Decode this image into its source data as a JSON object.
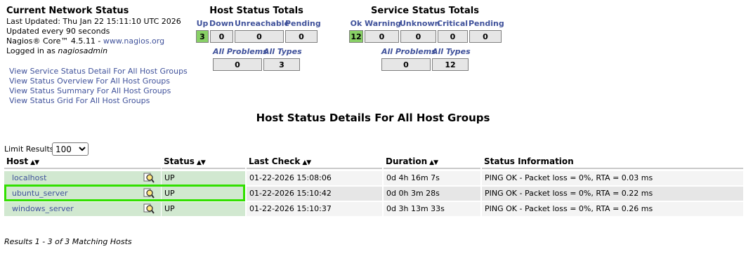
{
  "info": {
    "title": "Current Network Status",
    "last_updated": "Last Updated: Thu Jan 22 15:11:10 UTC 2026",
    "update_interval": "Updated every 90 seconds",
    "version_prefix": "Nagios® Core™ 4.5.11 - ",
    "version_link": "www.nagios.org",
    "logged_in_prefix": "Logged in as ",
    "user": "nagiosadmin"
  },
  "host_totals": {
    "title": "Host Status Totals",
    "headers": [
      "Up",
      "Down",
      "Unreachable",
      "Pending"
    ],
    "values": [
      "3",
      "0",
      "0",
      "0"
    ],
    "sub_headers": [
      "All Problems",
      "All Types"
    ],
    "sub_values": [
      "0",
      "3"
    ]
  },
  "service_totals": {
    "title": "Service Status Totals",
    "headers": [
      "Ok",
      "Warning",
      "Unknown",
      "Critical",
      "Pending"
    ],
    "values": [
      "12",
      "0",
      "0",
      "0",
      "0"
    ],
    "sub_headers": [
      "All Problems",
      "All Types"
    ],
    "sub_values": [
      "0",
      "12"
    ]
  },
  "links": [
    "View Service Status Detail For All Host Groups",
    "View Status Overview For All Host Groups",
    "View Status Summary For All Host Groups",
    "View Status Grid For All Host Groups"
  ],
  "page_title": "Host Status Details For All Host Groups",
  "limit": {
    "label": "Limit Results:",
    "selected": "100"
  },
  "columns": [
    "Host",
    "Status",
    "Last Check",
    "Duration",
    "Status Information"
  ],
  "hosts": [
    {
      "host": "localhost",
      "status": "UP",
      "last_check": "01-22-2026 15:08:06",
      "duration": "0d 4h 16m 7s",
      "info": "PING OK - Packet loss = 0%, RTA = 0.03 ms"
    },
    {
      "host": "ubuntu_server",
      "status": "UP",
      "last_check": "01-22-2026 15:10:42",
      "duration": "0d 0h 3m 28s",
      "info": "PING OK - Packet loss = 0%, RTA = 0.22 ms"
    },
    {
      "host": "windows_server",
      "status": "UP",
      "last_check": "01-22-2026 15:10:37",
      "duration": "0d 3h 13m 33s",
      "info": "PING OK - Packet loss = 0%, RTA = 0.26 ms"
    }
  ],
  "results": "Results 1 - 3 of 3 Matching Hosts",
  "colors": {
    "up_green": "#88d066",
    "row_green": "#d1e8d0",
    "link": "#40529b",
    "highlight": "#32e000"
  },
  "icons": {
    "host_detail": "magnifier-icon",
    "sort": "sort-arrows-icon"
  }
}
